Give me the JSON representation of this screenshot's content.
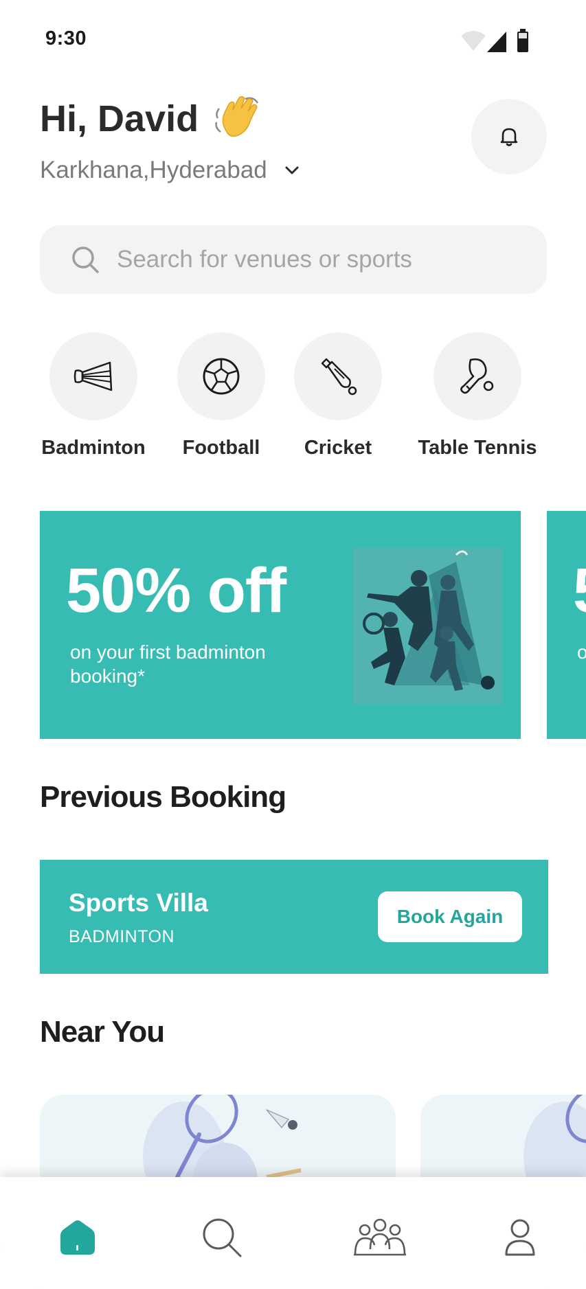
{
  "status_bar": {
    "time": "9:30",
    "icons": [
      "wifi-icon",
      "cellular-signal-icon",
      "battery-icon"
    ]
  },
  "header": {
    "greeting": "Hi, David",
    "greeting_emoji": "waving-hand-emoji",
    "location": "Karkhana,Hyderabad",
    "location_icon": "chevron-down-icon",
    "notification_icon": "bell-icon"
  },
  "search": {
    "placeholder": "Search for venues or sports",
    "icon": "search-icon"
  },
  "sports": [
    {
      "label": "Badminton",
      "icon": "shuttlecock-icon"
    },
    {
      "label": "Football",
      "icon": "football-icon"
    },
    {
      "label": "Cricket",
      "icon": "cricket-bat-icon"
    },
    {
      "label": "Table Tennis",
      "icon": "table-tennis-icon"
    }
  ],
  "promo": {
    "title": "50% off",
    "subtitle": "on your first badminton booking*",
    "next_peek_title": "5",
    "next_peek_subtitle": "o b",
    "accent_color": "#36bcb2"
  },
  "previous_booking": {
    "section_title": "Previous Booking",
    "venue": "Sports Villa",
    "sport": "BADMINTON",
    "button_label": "Book Again"
  },
  "near_you": {
    "section_title": "Near You"
  },
  "bottom_nav": {
    "items": [
      {
        "icon": "home-icon",
        "active": true
      },
      {
        "icon": "search-icon",
        "active": false
      },
      {
        "icon": "community-icon",
        "active": false
      },
      {
        "icon": "profile-icon",
        "active": false
      }
    ],
    "active_color": "#23a79d"
  }
}
